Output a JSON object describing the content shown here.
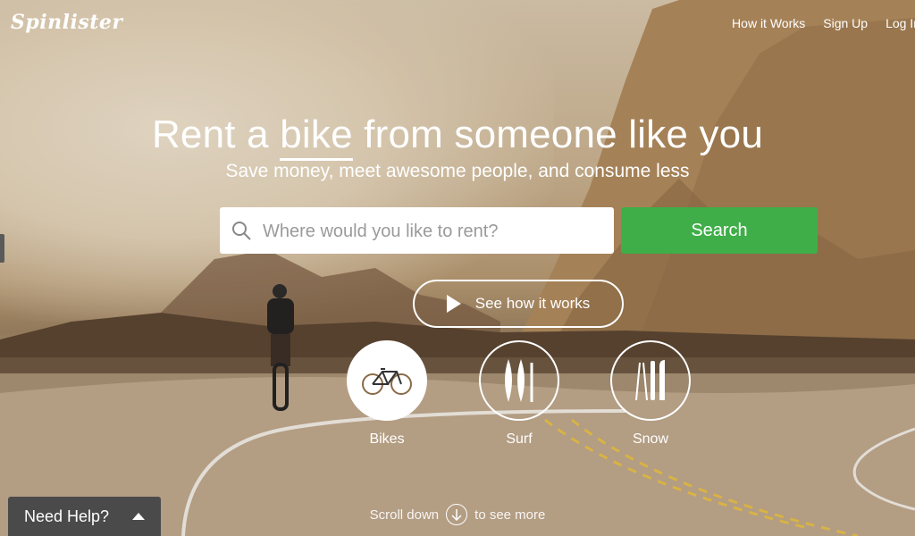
{
  "header": {
    "logo": "Spinlister",
    "nav": [
      "How it Works",
      "Sign Up",
      "Log In"
    ]
  },
  "hero": {
    "title_pre": "Rent a ",
    "title_highlight": "bike",
    "title_post": " from someone like you",
    "subtitle": "Save money, meet awesome people, and consume less"
  },
  "search": {
    "placeholder": "Where would you like to rent?",
    "button": "Search"
  },
  "how_button": "See how it works",
  "categories": [
    {
      "label": "Bikes",
      "icon": "bike-icon"
    },
    {
      "label": "Surf",
      "icon": "surfboard-icon"
    },
    {
      "label": "Snow",
      "icon": "ski-icon"
    }
  ],
  "scroll": {
    "pre": "Scroll down",
    "post": "to see more"
  },
  "help": {
    "label": "Need Help?"
  },
  "colors": {
    "accent": "#3fae48",
    "help_bg": "#4a4a4a"
  }
}
